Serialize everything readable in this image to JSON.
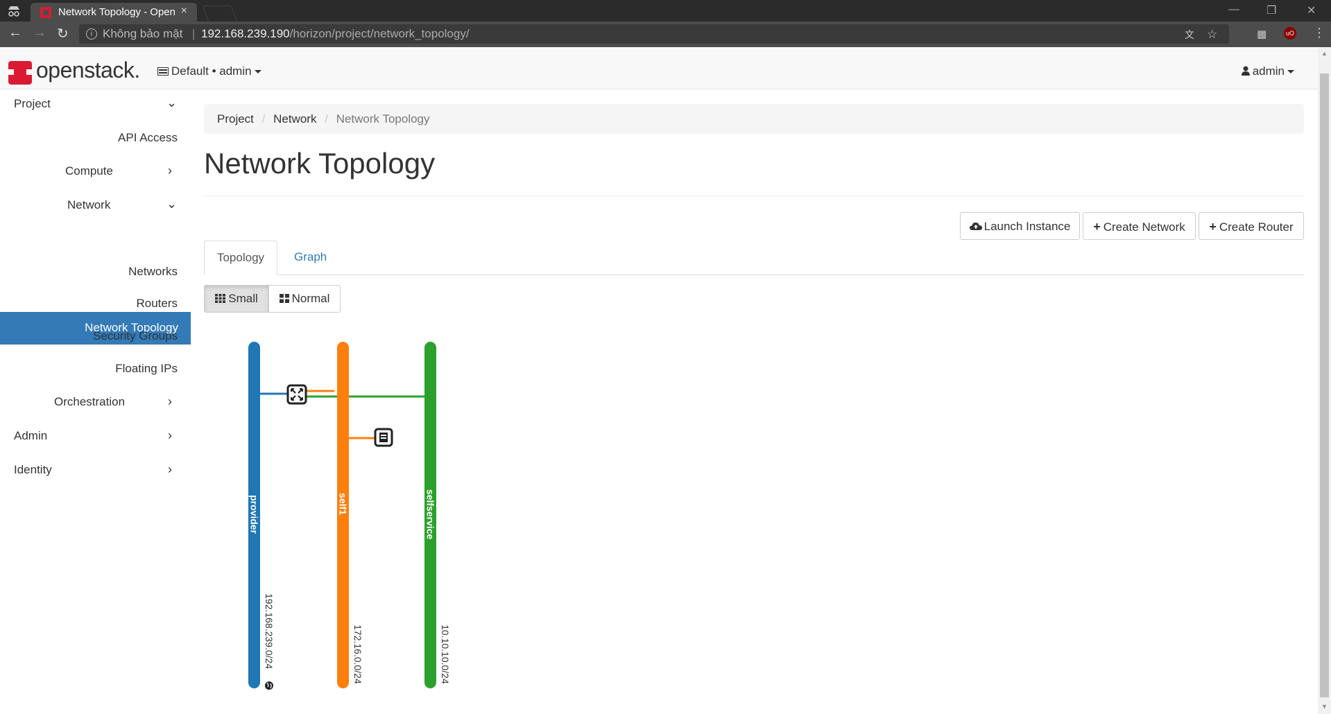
{
  "browser": {
    "tab_title": "Network Topology - Openstack",
    "tab_close": "×",
    "security_label": "Không bảo mật",
    "url_host": "192.168.239.190",
    "url_path": "/horizon/project/network_topology/"
  },
  "header": {
    "logo": "openstack.",
    "project_switcher": "Default • admin",
    "user": "admin"
  },
  "sidebar": {
    "items": [
      {
        "label": "Project",
        "expanded": true
      },
      {
        "label": "API Access"
      },
      {
        "label": "Compute",
        "expanded": false
      },
      {
        "label": "Network",
        "expanded": true
      },
      {
        "label": "Network Topology",
        "active": true
      },
      {
        "label": "Networks"
      },
      {
        "label": "Routers"
      },
      {
        "label": "Security Groups"
      },
      {
        "label": "Floating IPs"
      },
      {
        "label": "Orchestration",
        "expanded": false
      },
      {
        "label": "Admin",
        "expanded": false
      },
      {
        "label": "Identity",
        "expanded": false
      }
    ]
  },
  "breadcrumb": [
    "Project",
    "Network",
    "Network Topology"
  ],
  "page_title": "Network Topology",
  "actions": {
    "launch_instance": "Launch Instance",
    "create_network": "Create Network",
    "create_router": "Create Router"
  },
  "tabs": {
    "topology": "Topology",
    "graph": "Graph"
  },
  "view_toggle": {
    "small": "Small",
    "normal": "Normal",
    "selected": "Small"
  },
  "topology": {
    "networks": [
      {
        "name": "provider",
        "cidr": "192.168.239.0/24",
        "color": "#1f77b4",
        "external": true
      },
      {
        "name": "self1",
        "cidr": "172.16.0.0/24",
        "color": "#ff7f0e"
      },
      {
        "name": "selfservice",
        "cidr": "10.10.10.0/24",
        "color": "#2ca02c"
      }
    ],
    "router_icon": "router-icon",
    "instance_icon": "instance-icon"
  }
}
